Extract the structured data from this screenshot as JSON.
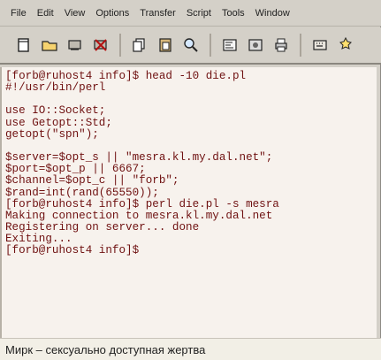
{
  "menu": {
    "items": [
      "File",
      "Edit",
      "View",
      "Options",
      "Transfer",
      "Script",
      "Tools",
      "Window"
    ]
  },
  "toolbar": {
    "icons": [
      "new-file-icon",
      "open-folder-icon",
      "close-session-icon",
      "disconnect-icon",
      "copy-icon",
      "paste-icon",
      "find-icon",
      "properties-icon",
      "settings-icon",
      "print-icon",
      "keymap-icon",
      "options-icon"
    ]
  },
  "terminal": {
    "lines": [
      "[forb@ruhost4 info]$ head -10 die.pl",
      "#!/usr/bin/perl",
      "",
      "use IO::Socket;",
      "use Getopt::Std;",
      "getopt(\"spn\");",
      "",
      "$server=$opt_s || \"mesra.kl.my.dal.net\";",
      "$port=$opt_p || 6667;",
      "$channel=$opt_c || \"forb\";",
      "$rand=int(rand(65550));",
      "[forb@ruhost4 info]$ perl die.pl -s mesra",
      "Making connection to mesra.kl.my.dal.net",
      "Registering on server... done",
      "Exiting...",
      "[forb@ruhost4 info]$"
    ]
  },
  "caption": {
    "text": "Мирк – сексуально доступная жертва"
  }
}
